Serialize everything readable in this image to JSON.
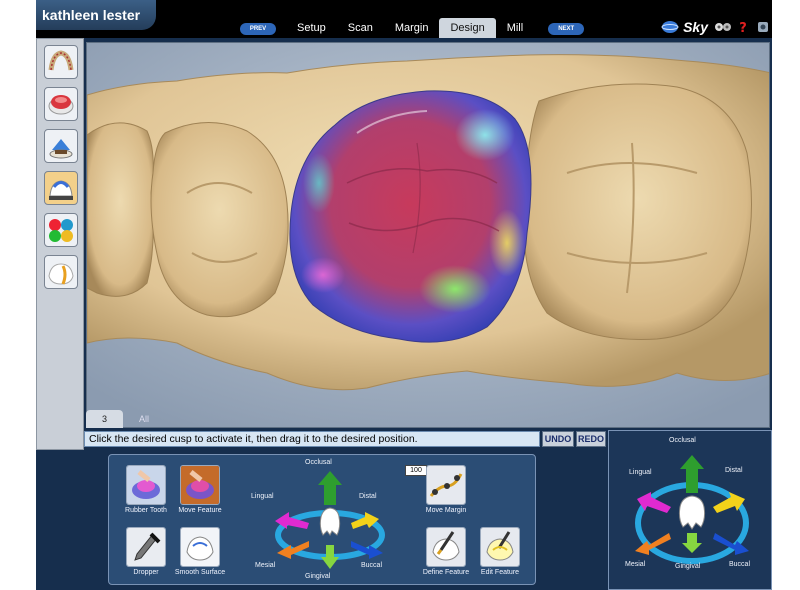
{
  "patient": {
    "name": "kathleen lester"
  },
  "nav": {
    "prev_label": "PREV",
    "next_label": "NEXT",
    "steps": [
      {
        "label": "Setup"
      },
      {
        "label": "Scan"
      },
      {
        "label": "Margin"
      },
      {
        "label": "Design",
        "active": true
      },
      {
        "label": "Mill"
      }
    ]
  },
  "brand": {
    "name": "Sky",
    "icons": [
      "globe-icon",
      "network-icon",
      "help-icon",
      "settings-icon"
    ]
  },
  "left_toolbar": {
    "tools": [
      "full-arch-icon",
      "crown-view-icon",
      "bite-icon",
      "cusp-design-icon",
      "color-map-icon",
      "contact-icon"
    ]
  },
  "tooth_tabs": [
    {
      "label": "3",
      "active": true
    },
    {
      "label": "All"
    }
  ],
  "status": {
    "message": "Click the desired cusp to activate it, then drag it to the desired position.",
    "undo_label": "UNDO",
    "redo_label": "REDO"
  },
  "tools": {
    "rubber_tooth": "Rubber Tooth",
    "move_feature": "Move Feature",
    "dropper": "Dropper",
    "smooth_surface": "Smooth Surface",
    "move_margin": "Move Margin",
    "define_feature": "Define Feature",
    "edit_feature": "Edit Feature"
  },
  "step_value": "100",
  "direction_control": {
    "occlusal": "Occlusal",
    "lingual": "Lingual",
    "distal": "Distal",
    "mesial": "Mesial",
    "buccal": "Buccal",
    "gingival": "Gingival"
  },
  "orientation": {
    "occlusal": "Occlusal",
    "lingual": "Lingual",
    "distal": "Distal",
    "mesial": "Mesial",
    "buccal": "Buccal",
    "gingival": "Gingival"
  },
  "arrow_colors": {
    "occlusal": "#2e9e2e",
    "gingival": "#86d640",
    "lingual": "#e02ad0",
    "distal": "#f2d21a",
    "mesial": "#f08020",
    "buccal": "#1a4fd0"
  }
}
